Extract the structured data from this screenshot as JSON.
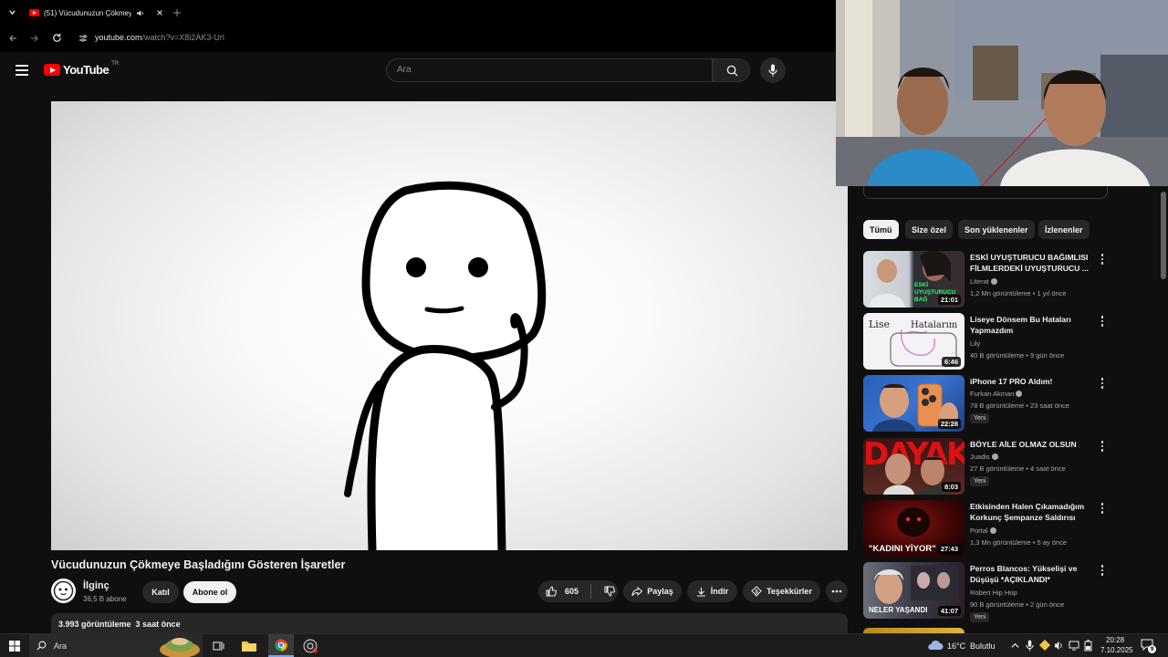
{
  "browser": {
    "tab_title": "(51) Vücudunuzun Çökmey",
    "url_host": "youtube.com",
    "url_path": "/watch?v=X8i2AK3-Url"
  },
  "header": {
    "logo_text": "YouTube",
    "logo_region": "TR",
    "search_placeholder": "Ara"
  },
  "video": {
    "title": "Vücudunuzun Çökmeye Başladığını Gösteren İşaretler",
    "channel": "İlginç",
    "subscribers": "36,5 B abone",
    "join_label": "Katıl",
    "subscribe_label": "Abone ol",
    "likes": "605",
    "share_label": "Paylaş",
    "download_label": "İndir",
    "thanks_label": "Teşekkürler",
    "views": "3.993 görüntüleme",
    "posted": "3 saat önce"
  },
  "chips": [
    "Tümü",
    "Size özel",
    "Son yüklenenler",
    "İzlenenler"
  ],
  "recommendations": [
    {
      "title": "ESKİ UYUŞTURUCU BAĞIMLISI FİLMLERDEKİ UYUŞTURUCU ...",
      "channel": "Literat",
      "verified": true,
      "meta": "1,2 Mn görüntüleme • 1 yıl önce",
      "duration": "21:01",
      "badge": ""
    },
    {
      "title": "Liseye Dönsem Bu Hataları Yapmazdım",
      "channel": "Lily",
      "verified": false,
      "meta": "40 B görüntüleme • 9 gün önce",
      "duration": "6:46",
      "badge": ""
    },
    {
      "title": "iPhone 17 PRO Aldım!",
      "channel": "Furkan Akman",
      "verified": true,
      "meta": "78 B görüntüleme • 23 saat önce",
      "duration": "22:28",
      "badge": "Yeni"
    },
    {
      "title": "BÖYLE AİLE OLMAZ OLSUN",
      "channel": "Juadis",
      "verified": true,
      "meta": "27 B görüntüleme • 4 saat önce",
      "duration": "8:03",
      "badge": "Yeni"
    },
    {
      "title": "Etkisinden Halen Çıkamadığım Korkunç Şempanze Saldırısı",
      "channel": "Portal",
      "verified": true,
      "meta": "1,3 Mn görüntüleme • 5 ay önce",
      "duration": "27:43",
      "badge": ""
    },
    {
      "title": "Perros Blancos: Yükselişi ve Düşüşü *AÇIKLANDI*",
      "channel": "Robert Hip Hop",
      "verified": false,
      "meta": "90 B görüntüleme • 2 gün önce",
      "duration": "41:07",
      "badge": "Yeni"
    }
  ],
  "thumb_texts": {
    "t1": "ESKİ UYUŞTURUCU BAĞ",
    "t2a": "Lise",
    "t2b": "Hatalarım",
    "t4": "DAYAK",
    "t5": "\"KADINI YİYOR\"",
    "t6": "NELER YAŞANDI"
  },
  "taskbar": {
    "search_label": "Ara",
    "temperature": "16°C",
    "weather": "Bulutlu",
    "time": "20:28",
    "date": "7.10.2025",
    "notif_count": "9"
  },
  "colors": {
    "accent": "#ff0000",
    "background": "#0f0f0f",
    "surface": "#272727"
  }
}
